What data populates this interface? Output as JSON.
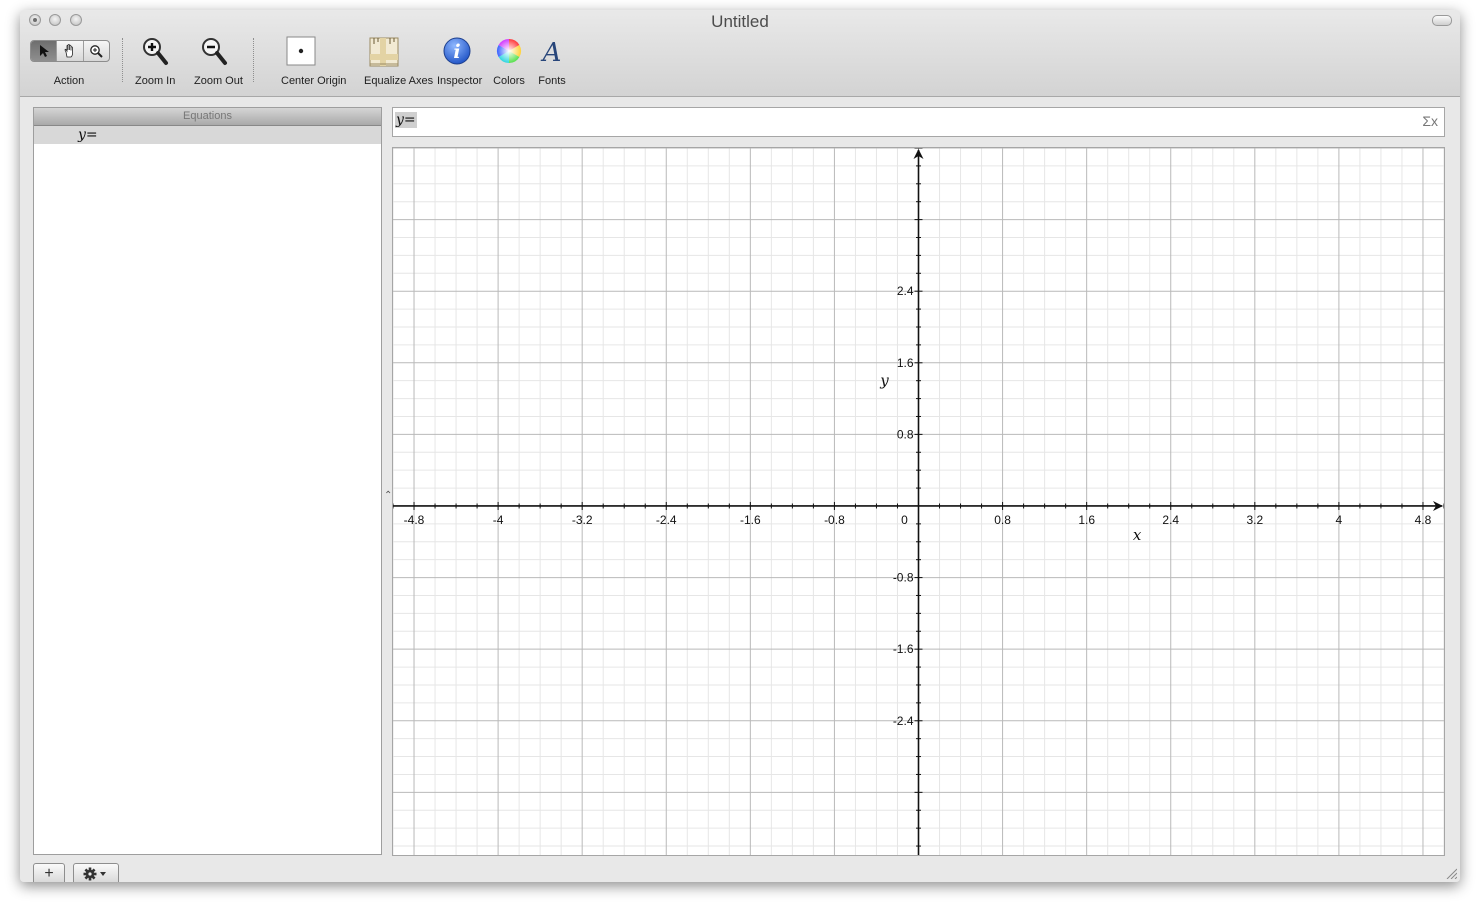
{
  "window": {
    "title": "Untitled"
  },
  "toolbar": {
    "action_label": "Action",
    "zoom_in_label": "Zoom In",
    "zoom_out_label": "Zoom Out",
    "center_origin_label": "Center Origin",
    "equalize_axes_label": "Equalize Axes",
    "inspector_label": "Inspector",
    "colors_label": "Colors",
    "fonts_label": "Fonts"
  },
  "equations": {
    "header": "Equations",
    "rows": [
      "y="
    ]
  },
  "equation_bar": {
    "value": "y=",
    "sigma_icon": "Σx"
  },
  "chart_data": {
    "type": "line",
    "series": [],
    "xlabel": "x",
    "ylabel": "y",
    "xlim": [
      -5.0,
      5.0
    ],
    "ylim": [
      -3.9,
      4.0
    ],
    "x_ticks": [
      "-4.8",
      "-4",
      "-3.2",
      "-2.4",
      "-1.6",
      "-0.8",
      "0",
      "0.8",
      "1.6",
      "2.4",
      "3.2",
      "4",
      "4.8"
    ],
    "y_ticks": [
      "2.4",
      "1.6",
      "0.8",
      "-0.8",
      "-1.6",
      "-2.4"
    ],
    "grid": true
  },
  "footer": {
    "add_label": "+",
    "gear_icon": "gear-icon"
  }
}
